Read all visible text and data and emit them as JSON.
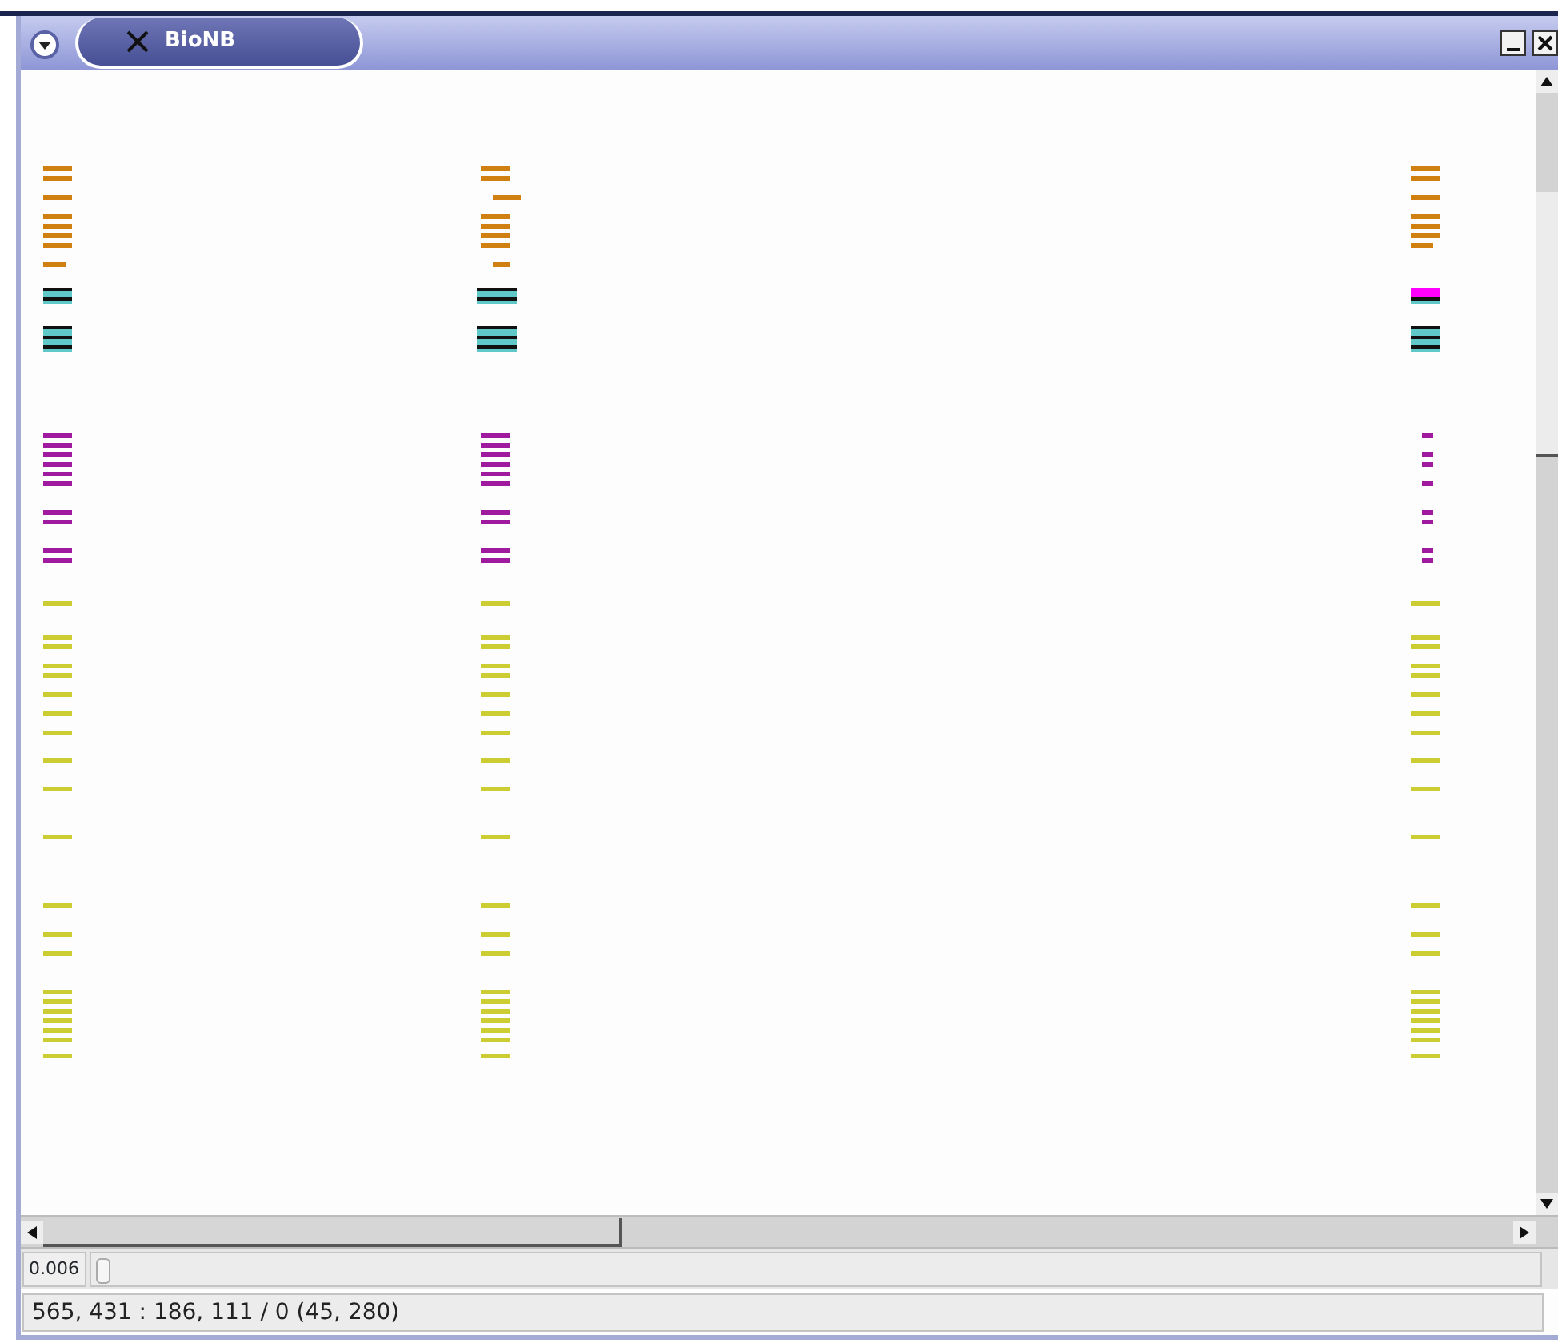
{
  "window": {
    "title": "BioNB"
  },
  "zoom": {
    "value": "0.006",
    "level": 0.0
  },
  "status_bar": {
    "text": "565, 431 : 186, 111 / 0 (45, 280)"
  }
}
